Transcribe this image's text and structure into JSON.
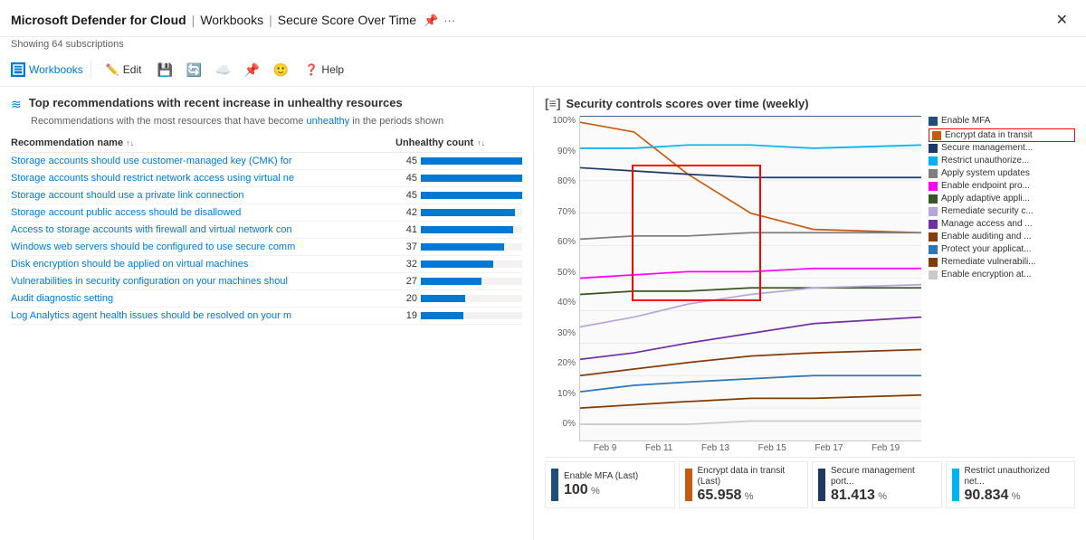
{
  "window": {
    "title": "Microsoft Defender for Cloud",
    "separator1": "|",
    "breadcrumb1": "Workbooks",
    "separator2": "|",
    "breadcrumb2": "Secure Score Over Time",
    "subtitle": "Showing 64 subscriptions"
  },
  "toolbar": {
    "workbooks_label": "Workbooks",
    "edit_label": "Edit",
    "help_label": "Help"
  },
  "left_section": {
    "title": "Top recommendations with recent increase in unhealthy resources",
    "subtitle_pre": "Recommendations with the most resources that have become ",
    "subtitle_highlight": "unhealthy",
    "subtitle_post": " in the periods shown",
    "col_name": "Recommendation name",
    "col_count": "Unhealthy count",
    "rows": [
      {
        "name": "Storage accounts should use customer-managed key (CMK) for",
        "count": 45,
        "bar": 100
      },
      {
        "name": "Storage accounts should restrict network access using virtual ne",
        "count": 45,
        "bar": 100
      },
      {
        "name": "Storage account should use a private link connection",
        "count": 45,
        "bar": 100
      },
      {
        "name": "Storage account public access should be disallowed",
        "count": 42,
        "bar": 93
      },
      {
        "name": "Access to storage accounts with firewall and virtual network con",
        "count": 41,
        "bar": 91
      },
      {
        "name": "Windows web servers should be configured to use secure comm",
        "count": 37,
        "bar": 82
      },
      {
        "name": "Disk encryption should be applied on virtual machines",
        "count": 32,
        "bar": 71
      },
      {
        "name": "Vulnerabilities in security configuration on your machines shoul",
        "count": 27,
        "bar": 60
      },
      {
        "name": "Audit diagnostic setting",
        "count": 20,
        "bar": 44
      },
      {
        "name": "Log Analytics agent health issues should be resolved on your m",
        "count": 19,
        "bar": 42
      }
    ]
  },
  "right_section": {
    "title": "Security controls scores over time (weekly)",
    "y_axis": [
      "100%",
      "90%",
      "80%",
      "70%",
      "60%",
      "50%",
      "40%",
      "30%",
      "20%",
      "10%",
      "0%"
    ],
    "x_axis": [
      "Feb 9",
      "Feb 11",
      "Feb 13",
      "Feb 15",
      "Feb 17",
      "Feb 19"
    ],
    "legend": [
      {
        "label": "Enable MFA",
        "color": "#1f4e79",
        "highlighted": false
      },
      {
        "label": "Encrypt data in transit",
        "color": "#c55a11",
        "highlighted": true
      },
      {
        "label": "Secure management...",
        "color": "#203864",
        "highlighted": false
      },
      {
        "label": "Restrict unauthorize...",
        "color": "#00b0f0",
        "highlighted": false
      },
      {
        "label": "Apply system updates",
        "color": "#7f7f7f",
        "highlighted": false
      },
      {
        "label": "Enable endpoint pro...",
        "color": "#ff00ff",
        "highlighted": false
      },
      {
        "label": "Apply adaptive appli...",
        "color": "#375623",
        "highlighted": false
      },
      {
        "label": "Remediate security c...",
        "color": "#b4a7d6",
        "highlighted": false
      },
      {
        "label": "Manage access and ...",
        "color": "#7030a0",
        "highlighted": false
      },
      {
        "label": "Enable auditing and ...",
        "color": "#843c0c",
        "highlighted": false
      },
      {
        "label": "Protect your applicat...",
        "color": "#2e75b6",
        "highlighted": false
      },
      {
        "label": "Remediate vulnerabili...",
        "color": "#833c00",
        "highlighted": false
      },
      {
        "label": "Enable encryption at...",
        "color": "#c9c9c9",
        "highlighted": false
      }
    ],
    "metrics": [
      {
        "label": "Enable MFA (Last)",
        "value": "100",
        "unit": "%",
        "color": "#1f4e79"
      },
      {
        "label": "Encrypt data in transit (Last)",
        "value": "65.958",
        "unit": "%",
        "color": "#c55a11"
      },
      {
        "label": "Secure management port...",
        "value": "81.413",
        "unit": "%",
        "color": "#203864"
      },
      {
        "label": "Restrict unauthorized net...",
        "value": "90.834",
        "unit": "%",
        "color": "#00b0f0"
      }
    ]
  }
}
